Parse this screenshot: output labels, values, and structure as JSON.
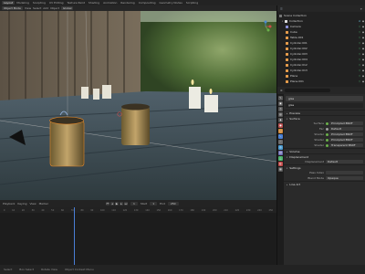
{
  "workspaces": [
    "Layout",
    "Modeling",
    "Sculpting",
    "UV Editing",
    "Texture Paint",
    "Shading",
    "Animation",
    "Rendering",
    "Compositing",
    "Geometry Nodes",
    "Scripting"
  ],
  "active_workspace": "Layout",
  "viewport_header": {
    "mode": "Object Mode",
    "view": "View",
    "select": "Select",
    "add": "Add",
    "object": "Object",
    "orientation": "Global"
  },
  "outliner": {
    "title": "Scene Collection",
    "collection": "Collection",
    "items": [
      {
        "name": "Camera",
        "icon": "camera-data-icon",
        "color": "#8a8fd6"
      },
      {
        "name": "Cube",
        "icon": "mesh-icon",
        "color": "#e69c4b"
      },
      {
        "name": "Table.001",
        "icon": "mesh-icon",
        "color": "#e69c4b"
      },
      {
        "name": "Cylinder.001",
        "icon": "mesh-icon",
        "color": "#e69c4b"
      },
      {
        "name": "Cylinder.002",
        "icon": "mesh-icon",
        "color": "#e69c4b"
      },
      {
        "name": "Cylinder.003",
        "icon": "mesh-icon",
        "color": "#e69c4b"
      },
      {
        "name": "Cylinder.004",
        "icon": "mesh-icon",
        "color": "#e69c4b"
      },
      {
        "name": "Cylinder.012",
        "icon": "mesh-icon",
        "color": "#e69c4b"
      },
      {
        "name": "Cylinder.013",
        "icon": "mesh-icon",
        "color": "#e69c4b"
      },
      {
        "name": "Plane",
        "icon": "mesh-icon",
        "color": "#e69c4b"
      },
      {
        "name": "Plane.001",
        "icon": "mesh-icon",
        "color": "#e69c4b"
      }
    ]
  },
  "properties": {
    "search_placeholder": "",
    "material_slot": "glas",
    "material_name": "glas",
    "panels": {
      "preview": "Preview",
      "surface": "Surface",
      "volume": "Volume",
      "displacement": "Displacement",
      "settings": "Settings",
      "lineart": "Line Art"
    },
    "surface": [
      {
        "label": "Surface",
        "value": "Principled BSDF"
      },
      {
        "label": "Fac",
        "value": "Default"
      },
      {
        "label": "Shader",
        "value": "Principled BSDF"
      },
      {
        "label": "Shader",
        "value": "Principled BSDF"
      },
      {
        "label": "Shader",
        "value": "Transparent BSDF"
      }
    ],
    "displacement": {
      "label": "Displacement",
      "value": "Default"
    },
    "settings": {
      "pass_index": "Pass Index",
      "blend_mode": "Blend Mode",
      "blend_value": "Opaque"
    }
  },
  "timeline": {
    "playback": "Playback",
    "keying": "Keying",
    "view": "View",
    "marker": "Marker",
    "current_frame": "1",
    "start_label": "Start",
    "start": "1",
    "end_label": "End",
    "end": "250",
    "ruler": [
      "0",
      "10",
      "20",
      "30",
      "40",
      "50",
      "60",
      "70",
      "80",
      "90",
      "100",
      "110",
      "120",
      "130",
      "140",
      "150",
      "160",
      "170",
      "180",
      "190",
      "200",
      "210",
      "220",
      "230",
      "240",
      "250"
    ]
  },
  "statusbar": {
    "select": "Select",
    "box": "Box Select",
    "rotate": "Rotate View",
    "menu": "Object Context Menu"
  }
}
